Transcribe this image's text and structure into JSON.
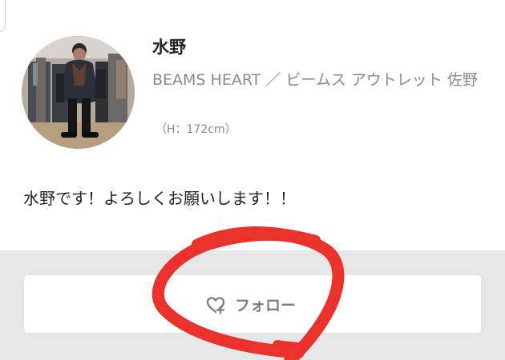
{
  "profile": {
    "name": "水野",
    "shop": "BEAMS HEART ／ ビームス アウトレット 佐野",
    "height": "（H：172cm）",
    "bio": "水野です！よろしくお願いします！！"
  },
  "follow": {
    "label": "フォロー",
    "icon": "heart-plus-icon"
  },
  "colors": {
    "text_primary": "#242424",
    "text_secondary": "#8a8a8a",
    "section_background": "#e7e7e7",
    "annotation": "#e8322b"
  }
}
